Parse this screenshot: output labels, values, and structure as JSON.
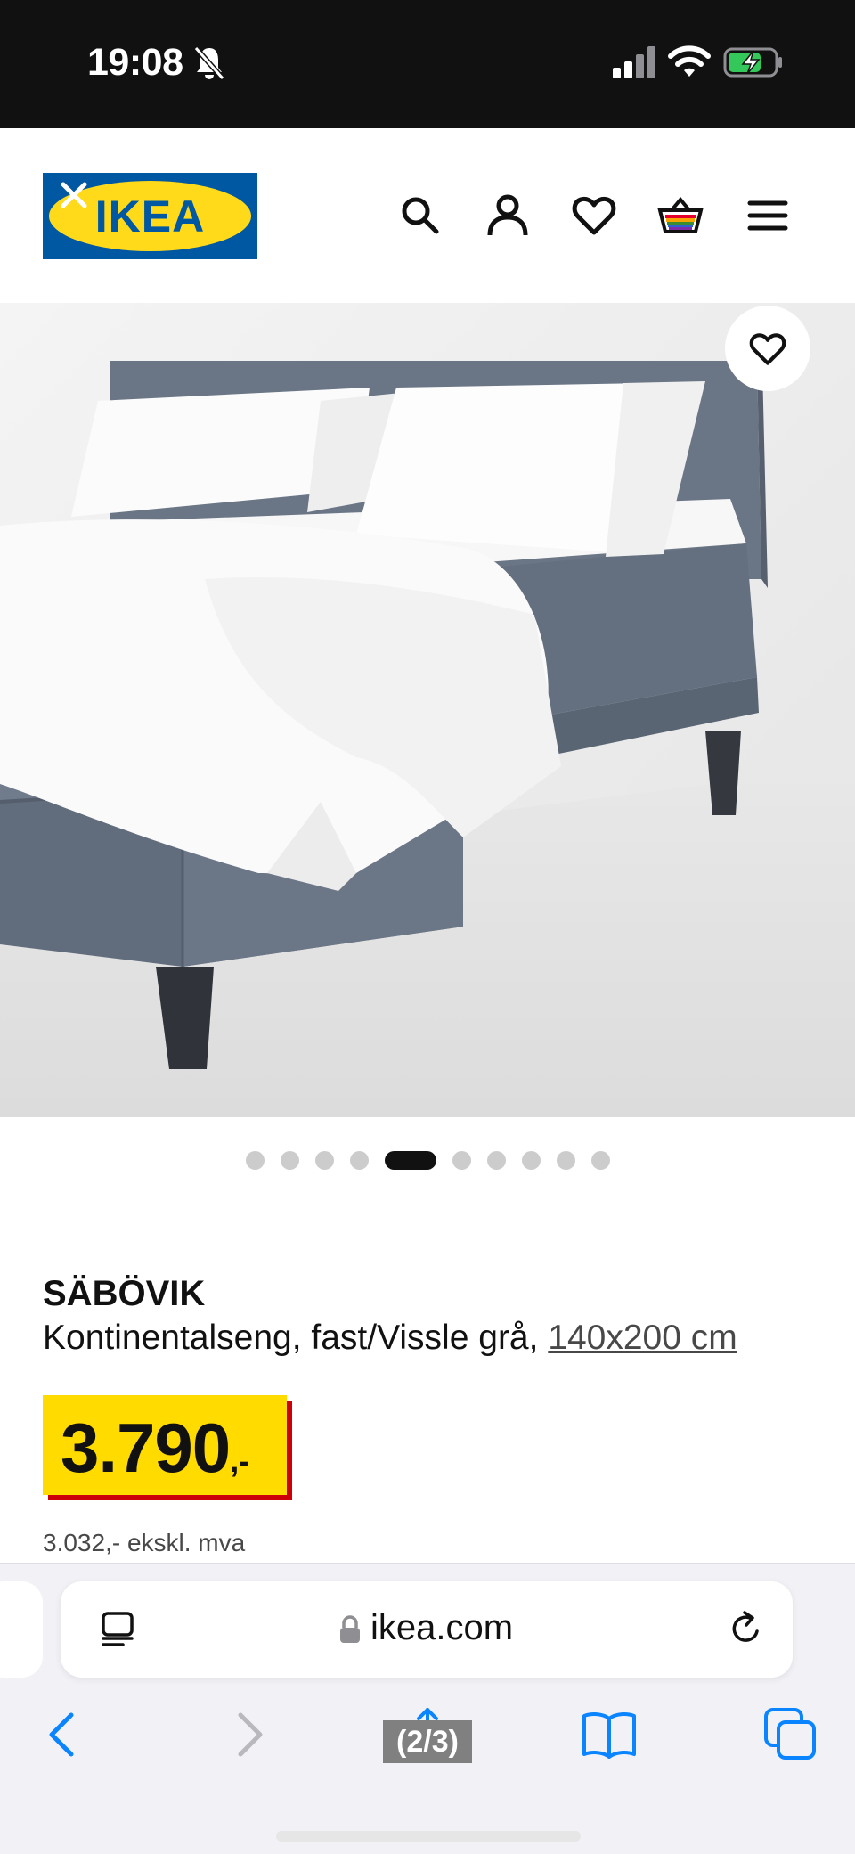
{
  "status_bar": {
    "time": "19:08"
  },
  "header": {
    "logo_text": "IKEA",
    "logo_colors": {
      "background": "#0058a3",
      "oval": "#ffda1a"
    },
    "icons": [
      "search-icon",
      "account-icon",
      "heart-icon",
      "shopping-bag-icon",
      "menu-icon"
    ]
  },
  "gallery": {
    "total_images": 10,
    "active_index": 4
  },
  "product": {
    "name": "SÄBÖVIK",
    "description": "Kontinentalseng, fast/Vissle grå, ",
    "size": "140x200 cm",
    "price_integer": "3.790",
    "price_suffix": ",-",
    "price_ex_vat": "3.032,- ekskl. mva",
    "price_colors": {
      "box": "#ffdb00",
      "shadow": "#cc0008"
    }
  },
  "browser": {
    "url": "ikea.com",
    "tab_counter": "(2/3)",
    "accent": "#0a84ff"
  }
}
